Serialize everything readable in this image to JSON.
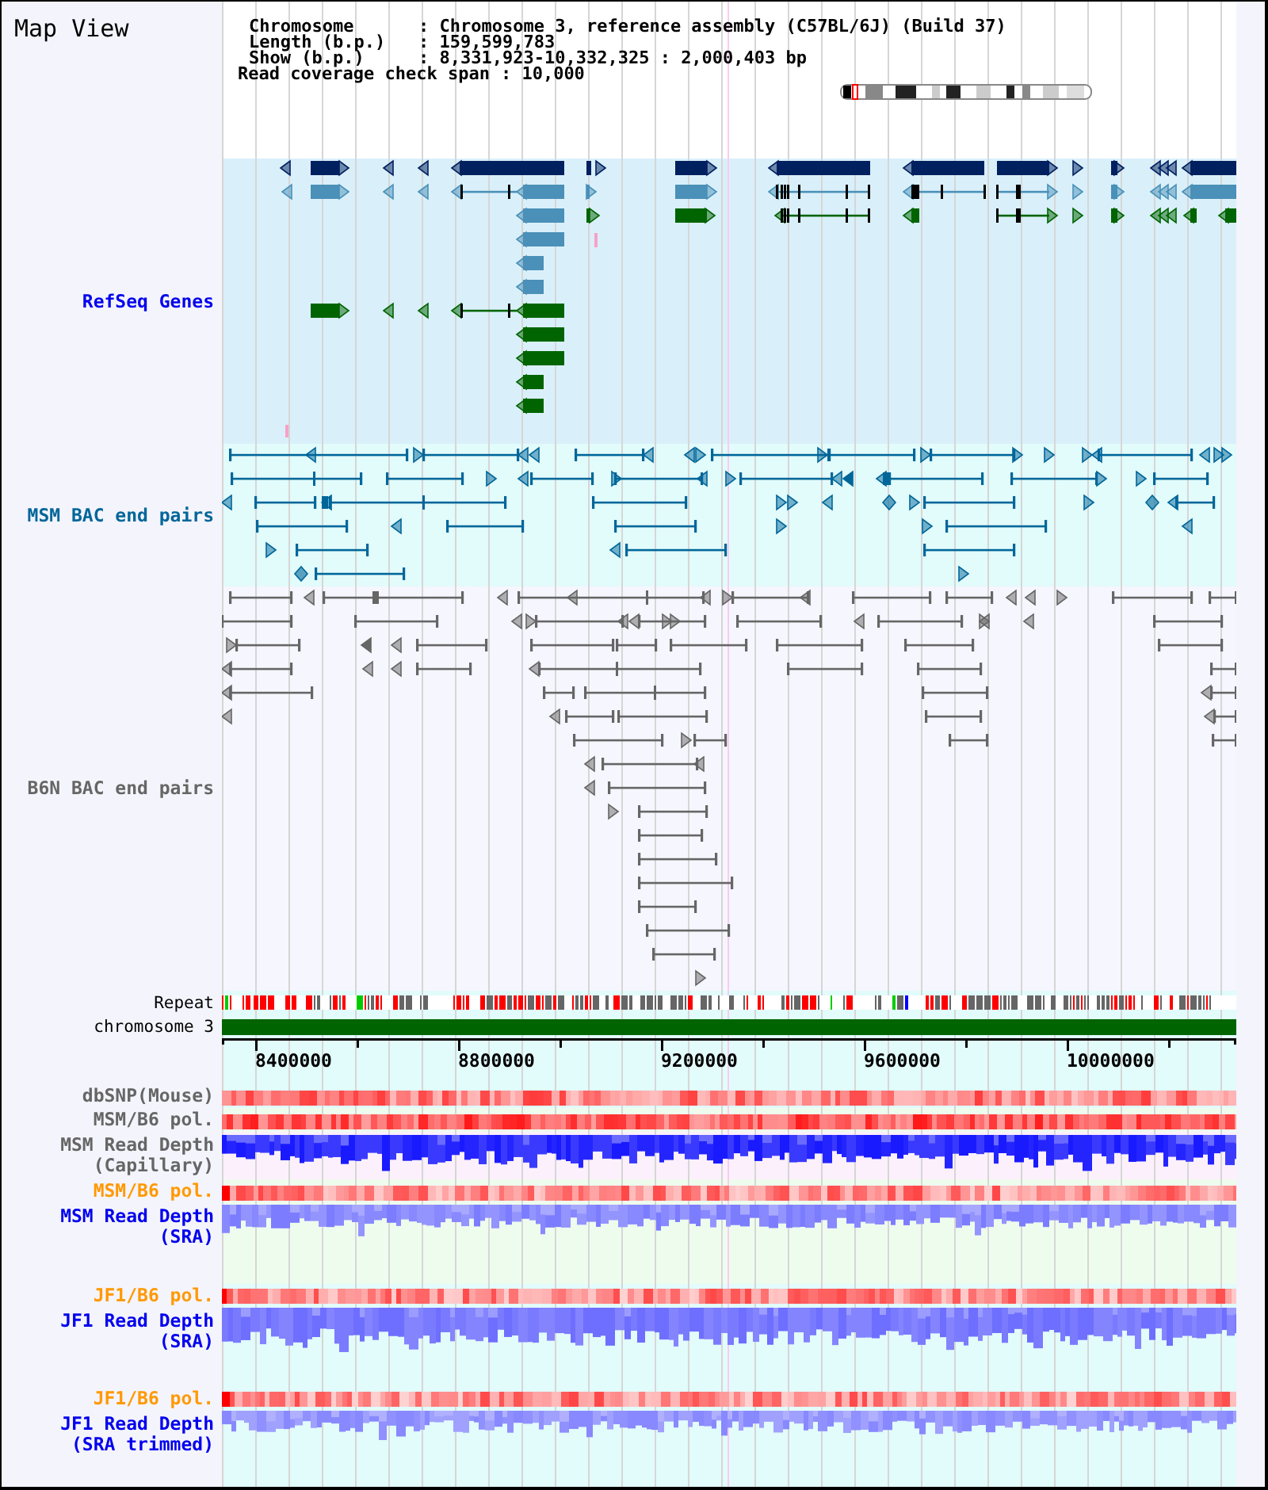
{
  "title": "Map View",
  "info": [
    {
      "label": "Chromosome",
      "value": ": Chromosome 3, reference assembly (C57BL/6J) (Build 37)"
    },
    {
      "label": "Length (b.p.)",
      "value": ": 159,599,783"
    },
    {
      "label": "Show (b.p.)",
      "value": ": 8,331,923-10,332,325 : 2,000,403 bp"
    },
    {
      "label": "Read coverage check span",
      "value": ": 10,000"
    }
  ],
  "tracks": [
    {
      "kind": "genes",
      "label": "RefSeq Genes",
      "color": "#0000ee"
    },
    {
      "kind": "bac_pairs",
      "label": "MSM BAC end pairs",
      "color": "#006699"
    },
    {
      "kind": "bac_pairs",
      "label": "B6N BAC end pairs",
      "color": "#666666"
    },
    {
      "kind": "repeat",
      "label": "Repeat",
      "color": "#000000"
    },
    {
      "kind": "chromosome",
      "label": "chromosome 3",
      "color": "#000000"
    },
    {
      "kind": "axis",
      "tick_labels": [
        "8400000",
        "8800000",
        "9200000",
        "9600000",
        "10000000"
      ]
    },
    {
      "kind": "heat",
      "label": "dbSNP(Mouse)",
      "color": "#666666"
    },
    {
      "kind": "heat",
      "label": "MSM/B6 pol.",
      "color": "#666666"
    },
    {
      "kind": "depth",
      "label": "MSM Read Depth",
      "sublabel": "(Capillary)",
      "color": "#666666"
    },
    {
      "kind": "heat",
      "label": "MSM/B6 pol.",
      "color": "#ff9900"
    },
    {
      "kind": "depth",
      "label": "MSM Read Depth",
      "sublabel": "(SRA)",
      "color": "#0000ee"
    },
    {
      "kind": "heat",
      "label": "JF1/B6 pol.",
      "color": "#ff9900"
    },
    {
      "kind": "depth",
      "label": "JF1 Read Depth",
      "sublabel": "(SRA)",
      "color": "#0000ee"
    },
    {
      "kind": "heat",
      "label": "JF1/B6 pol.",
      "color": "#ff9900"
    },
    {
      "kind": "depth",
      "label": "JF1 Read Depth",
      "sublabel": "(SRA trimmed)",
      "color": "#0000ee"
    }
  ]
}
